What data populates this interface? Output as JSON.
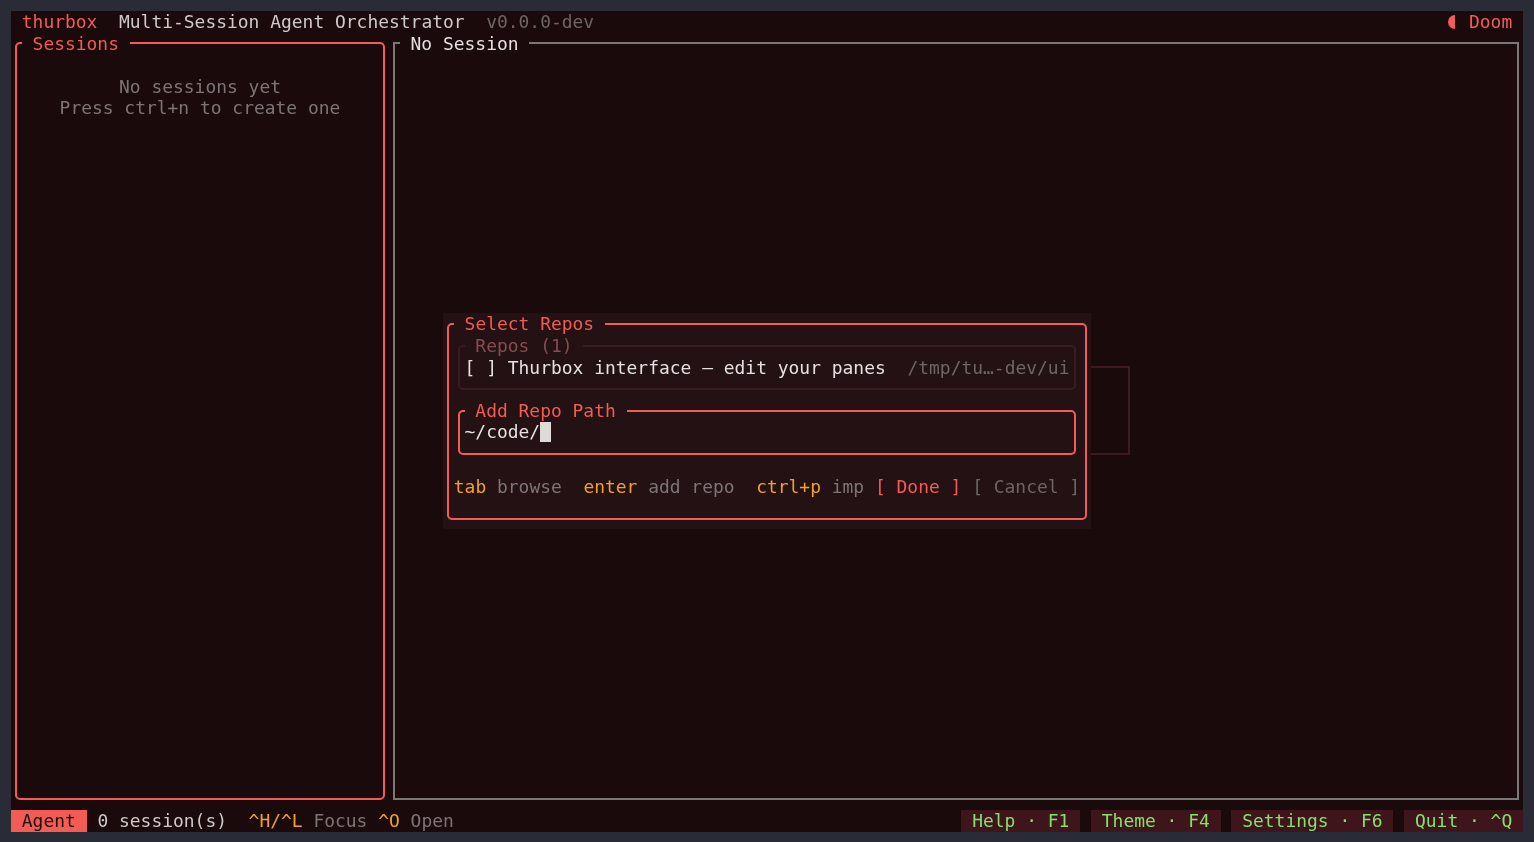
{
  "header": {
    "app_name": "thurbox",
    "title": "Multi-Session Agent Orchestrator",
    "version": "v0.0.0-dev",
    "theme": "Doom"
  },
  "panels": [
    {
      "title": "Sessions",
      "focused": true,
      "lines": [
        "No sessions yet",
        "Press ctrl+n to create one"
      ]
    },
    {
      "title": "No Session",
      "focused": false
    }
  ],
  "dialog": {
    "title": "Select Repos",
    "repo_list": {
      "title": "Repos (1)",
      "focused": false,
      "items": [
        {
          "checkbox": "[ ]",
          "checked": false,
          "name": "Thurbox interface — edit your panes",
          "path": "/tmp/tu…-dev/ui"
        }
      ]
    },
    "path_field": {
      "title": "Add Repo Path",
      "value": "~/code/",
      "focused": true
    },
    "hints": [
      {
        "key": "tab",
        "action": "browse"
      },
      {
        "key": "enter",
        "action": "add repo"
      },
      {
        "key": "ctrl+p",
        "action": "imp"
      }
    ],
    "buttons": [
      {
        "label": "[ Done ]",
        "selected": true
      },
      {
        "label": "[ Cancel ]",
        "selected": false
      }
    ]
  },
  "status_bar": {
    "mode": "Agent",
    "sessions": "0 session(s)",
    "hints": [
      {
        "key": "^H/^L",
        "action": "Focus"
      },
      {
        "key": "^O",
        "action": "Open"
      }
    ],
    "shortcuts": [
      "Help · F1",
      "Theme · F4",
      "Settings · F6",
      "Quit · ^Q"
    ]
  }
}
